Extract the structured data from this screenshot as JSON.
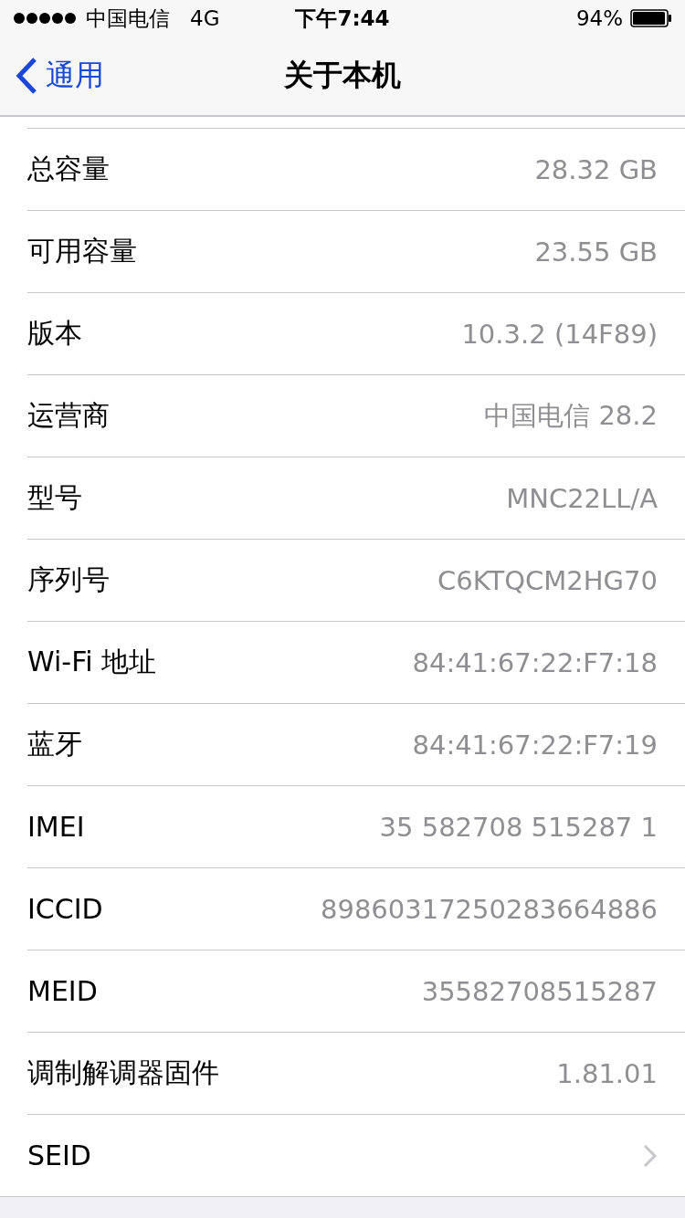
{
  "status_bar": {
    "carrier": "中国电信",
    "network": "4G",
    "time": "下午7:44",
    "battery": "94%"
  },
  "nav": {
    "back": "通用",
    "title": "关于本机"
  },
  "rows": [
    {
      "kind": "value",
      "label": "总容量",
      "value": "28.32 GB"
    },
    {
      "kind": "value",
      "label": "可用容量",
      "value": "23.55 GB"
    },
    {
      "kind": "value",
      "label": "版本",
      "value": "10.3.2 (14F89)"
    },
    {
      "kind": "value",
      "label": "运营商",
      "value": "中国电信 28.2"
    },
    {
      "kind": "value",
      "label": "型号",
      "value": "MNC22LL/A"
    },
    {
      "kind": "value",
      "label": "序列号",
      "value": "C6KTQCM2HG70"
    },
    {
      "kind": "value",
      "label": "Wi-Fi 地址",
      "value": "84:41:67:22:F7:18"
    },
    {
      "kind": "value",
      "label": "蓝牙",
      "value": "84:41:67:22:F7:19"
    },
    {
      "kind": "value",
      "label": "IMEI",
      "value": "35 582708 515287 1"
    },
    {
      "kind": "value",
      "label": "ICCID",
      "value": "89860317250283664886"
    },
    {
      "kind": "value",
      "label": "MEID",
      "value": "35582708515287"
    },
    {
      "kind": "value",
      "label": "调制解调器固件",
      "value": "1.81.01"
    },
    {
      "kind": "link",
      "label": "SEID"
    }
  ]
}
